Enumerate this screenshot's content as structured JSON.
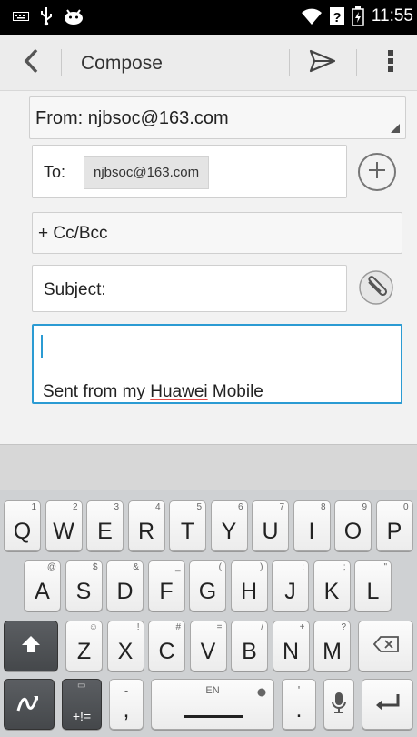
{
  "status_bar": {
    "time": "11:55",
    "left_icons": [
      "keyboard-icon",
      "usb-icon",
      "android-icon"
    ],
    "right_icons": [
      "wifi-icon",
      "signal-unknown-icon",
      "battery-icon"
    ]
  },
  "action_bar": {
    "title": "Compose",
    "icons": [
      "back-icon",
      "send-icon",
      "overflow-menu-icon"
    ]
  },
  "compose": {
    "from": "From: njbsoc@163.com",
    "to_label": "To:",
    "to_recipient": "njbsoc@163.com",
    "cc_bcc": "+ Cc/Bcc",
    "subject_placeholder": "Subject:",
    "signature_prefix": "Sent from my ",
    "signature_brand": "Huawei",
    "signature_suffix": " Mobile"
  },
  "keyboard": {
    "row1": [
      {
        "key": "Q",
        "hint": "1"
      },
      {
        "key": "W",
        "hint": "2"
      },
      {
        "key": "E",
        "hint": "3"
      },
      {
        "key": "R",
        "hint": "4"
      },
      {
        "key": "T",
        "hint": "5"
      },
      {
        "key": "Y",
        "hint": "6"
      },
      {
        "key": "U",
        "hint": "7"
      },
      {
        "key": "I",
        "hint": "8"
      },
      {
        "key": "O",
        "hint": "9"
      },
      {
        "key": "P",
        "hint": "0"
      }
    ],
    "row2": [
      {
        "key": "A",
        "hint": "@"
      },
      {
        "key": "S",
        "hint": "$"
      },
      {
        "key": "D",
        "hint": "&"
      },
      {
        "key": "F",
        "hint": "_"
      },
      {
        "key": "G",
        "hint": "("
      },
      {
        "key": "H",
        "hint": ")"
      },
      {
        "key": "J",
        "hint": ":"
      },
      {
        "key": "K",
        "hint": ";"
      },
      {
        "key": "L",
        "hint": "\""
      }
    ],
    "row3": [
      {
        "key": "Z",
        "hint": "☺"
      },
      {
        "key": "X",
        "hint": "!"
      },
      {
        "key": "C",
        "hint": "#"
      },
      {
        "key": "V",
        "hint": "="
      },
      {
        "key": "B",
        "hint": "/"
      },
      {
        "key": "N",
        "hint": "+"
      },
      {
        "key": "M",
        "hint": "?"
      }
    ],
    "symbols_key": "+!=",
    "comma_key": ",",
    "comma_hint": "-",
    "space_label": "EN",
    "period_key": ".",
    "period_hint": "'",
    "icons": [
      "shift-icon",
      "backspace-icon",
      "swype-icon",
      "microphone-icon",
      "enter-icon",
      "globe-icon"
    ]
  }
}
